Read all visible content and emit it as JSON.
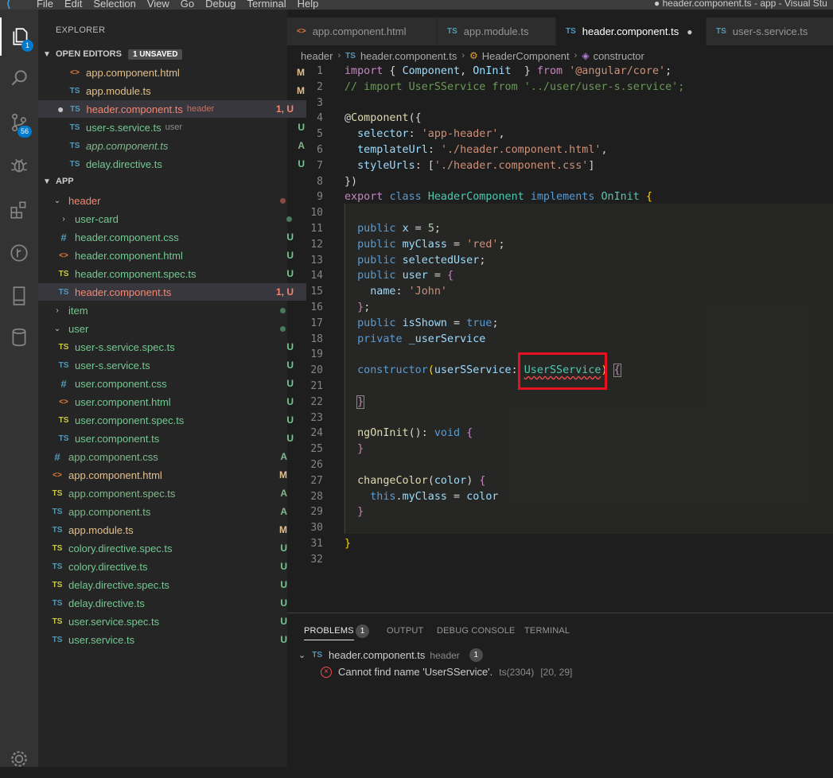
{
  "titlebar": {
    "menu": [
      "File",
      "Edit",
      "Selection",
      "View",
      "Go",
      "Debug",
      "Terminal",
      "Help"
    ],
    "window_title": "● header.component.ts - app - Visual Stu"
  },
  "activity": {
    "explorer_badge": "1",
    "scm_badge": "56"
  },
  "sidebar": {
    "title": "EXPLORER",
    "open_editors": {
      "label": "OPEN EDITORS",
      "unsaved": "1 UNSAVED",
      "items": [
        {
          "icon": "<>",
          "name": "app.component.html",
          "desc": "",
          "status": "M"
        },
        {
          "icon": "TS",
          "name": "app.module.ts",
          "desc": "",
          "status": "M"
        },
        {
          "icon": "TS",
          "name": "header.component.ts",
          "desc": "header",
          "status": "1, U"
        },
        {
          "icon": "TS",
          "name": "user-s.service.ts",
          "desc": "user",
          "status": "U"
        },
        {
          "icon": "TS",
          "name": "app.component.ts",
          "desc": "",
          "status": "A"
        },
        {
          "icon": "TS",
          "name": "delay.directive.ts",
          "desc": "",
          "status": "U"
        }
      ]
    },
    "app": {
      "label": "APP",
      "tree": [
        {
          "icon": "v",
          "name": "header",
          "status": ""
        },
        {
          "icon": ">",
          "name": "user-card",
          "status": ""
        },
        {
          "icon": "#",
          "name": "header.component.css",
          "status": "U"
        },
        {
          "icon": "<>",
          "name": "header.component.html",
          "status": "U"
        },
        {
          "icon": "TS",
          "name": "header.component.spec.ts",
          "status": "U"
        },
        {
          "icon": "TS",
          "name": "header.component.ts",
          "status": "1, U"
        },
        {
          "icon": ">",
          "name": "item",
          "status": ""
        },
        {
          "icon": "v",
          "name": "user",
          "status": ""
        },
        {
          "icon": "TS",
          "name": "user-s.service.spec.ts",
          "status": "U"
        },
        {
          "icon": "TS",
          "name": "user-s.service.ts",
          "status": "U"
        },
        {
          "icon": "#",
          "name": "user.component.css",
          "status": "U"
        },
        {
          "icon": "<>",
          "name": "user.component.html",
          "status": "U"
        },
        {
          "icon": "TS",
          "name": "user.component.spec.ts",
          "status": "U"
        },
        {
          "icon": "TS",
          "name": "user.component.ts",
          "status": "U"
        },
        {
          "icon": "#",
          "name": "app.component.css",
          "status": "A"
        },
        {
          "icon": "<>",
          "name": "app.component.html",
          "status": "M"
        },
        {
          "icon": "TS",
          "name": "app.component.spec.ts",
          "status": "A"
        },
        {
          "icon": "TS",
          "name": "app.component.ts",
          "status": "A"
        },
        {
          "icon": "TS",
          "name": "app.module.ts",
          "status": "M"
        },
        {
          "icon": "TS",
          "name": "colory.directive.spec.ts",
          "status": "U"
        },
        {
          "icon": "TS",
          "name": "colory.directive.ts",
          "status": "U"
        },
        {
          "icon": "TS",
          "name": "delay.directive.spec.ts",
          "status": "U"
        },
        {
          "icon": "TS",
          "name": "delay.directive.ts",
          "status": "U"
        },
        {
          "icon": "TS",
          "name": "user.service.spec.ts",
          "status": "U"
        },
        {
          "icon": "TS",
          "name": "user.service.ts",
          "status": "U"
        }
      ]
    }
  },
  "tabs": [
    {
      "icon": "<>",
      "label": "app.component.html"
    },
    {
      "icon": "TS",
      "label": "app.module.ts"
    },
    {
      "icon": "TS",
      "label": "header.component.ts"
    },
    {
      "icon": "TS",
      "label": "user-s.service.ts"
    }
  ],
  "breadcrumb": [
    "header",
    "TS",
    "header.component.ts",
    "HeaderComponent",
    "constructor"
  ],
  "line_numbers": [
    "1",
    "2",
    "3",
    "4",
    "5",
    "6",
    "7",
    "8",
    "9",
    "10",
    "11",
    "12",
    "13",
    "14",
    "15",
    "16",
    "17",
    "18",
    "19",
    "20",
    "21",
    "22",
    "23",
    "24",
    "25",
    "26",
    "27",
    "28",
    "29",
    "30",
    "31",
    "32"
  ],
  "code": {
    "l1": [
      "import",
      " { ",
      "Component",
      ", ",
      "OnInit",
      "  } ",
      "from",
      " ",
      "'@angular/core'",
      ";"
    ],
    "l2": "// import UserSService from '../user/user-s.service';",
    "l4": [
      "@",
      "Component",
      "({"
    ],
    "l5": [
      "  selector",
      ": ",
      "'app-header'",
      ","
    ],
    "l6": [
      "  templateUrl",
      ": ",
      "'./header.component.html'",
      ","
    ],
    "l7": [
      "  styleUrls",
      ": [",
      "'./header.component.css'",
      "]"
    ],
    "l8": "})",
    "l9": [
      "export",
      " ",
      "class",
      " ",
      "HeaderComponent",
      " ",
      "implements",
      " ",
      "OnInit",
      " ",
      "{"
    ],
    "l11": [
      "  public",
      " ",
      "x",
      " = ",
      "5",
      ";"
    ],
    "l12": [
      "  public",
      " ",
      "myClass",
      " = ",
      "'red'",
      ";"
    ],
    "l13": [
      "  public",
      " ",
      "selectedUser",
      ";"
    ],
    "l14": [
      "  public",
      " ",
      "user",
      " = ",
      "{"
    ],
    "l15": [
      "    name",
      ": ",
      "'John'"
    ],
    "l16": [
      "  ",
      "}",
      ";"
    ],
    "l17": [
      "  public",
      " ",
      "isShown",
      " = ",
      "true",
      ";"
    ],
    "l18": [
      "  private",
      " ",
      "_userService"
    ],
    "l20": [
      "  constructor",
      "(",
      "userSService",
      ": ",
      "UserSService",
      ")",
      " ",
      "{"
    ],
    "l22": [
      "  ",
      "}"
    ],
    "l24": [
      "  ngOnInit",
      "(): ",
      "void",
      " ",
      "{"
    ],
    "l25": [
      "  ",
      "}"
    ],
    "l27": [
      "  changeColor",
      "(",
      "color",
      ") ",
      "{"
    ],
    "l28": [
      "    ",
      "this",
      ".",
      "myClass",
      " = ",
      "color"
    ],
    "l29": [
      "  ",
      "}"
    ],
    "l31": "}"
  },
  "panel": {
    "tabs": [
      "PROBLEMS",
      "OUTPUT",
      "DEBUG CONSOLE",
      "TERMINAL"
    ],
    "problems_count": "1",
    "file_icon": "TS",
    "file": "header.component.ts",
    "folder": "header",
    "file_count": "1",
    "error_msg": "Cannot find name 'UserSService'.",
    "error_code": "ts(2304)",
    "error_pos": "[20, 29]"
  }
}
